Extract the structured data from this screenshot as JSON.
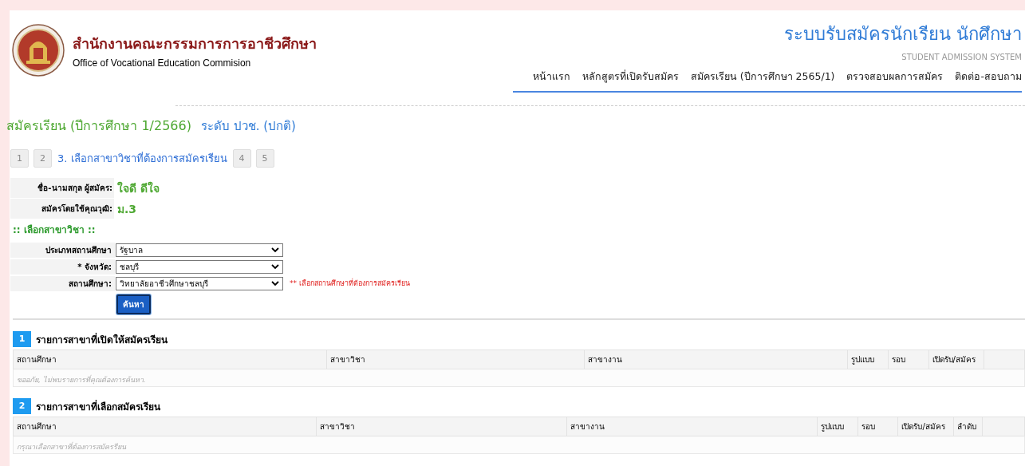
{
  "header": {
    "org_name_th": "สำนักงานคณะกรรมการการอาชีวศึกษา",
    "org_name_en": "Office of Vocational Education Commision",
    "system_title": "ระบบรับสมัครนักเรียน นักศึกษา",
    "system_subtitle": "STUDENT ADMISSION SYSTEM"
  },
  "nav": [
    "หน้าแรก",
    "หลักสูตรที่เปิดรับสมัคร",
    "สมัครเรียน (ปีการศึกษา 2565/1)",
    "ตรวจสอบผลการสมัคร",
    "ติดต่อ-สอบถาม"
  ],
  "page_title": "สมัครเรียน (ปีการศึกษา 1/2566)",
  "level_label": "ระดับ ปวช. (ปกติ)",
  "steps": [
    {
      "label": "1",
      "selected": false
    },
    {
      "label": "2",
      "selected": false
    },
    {
      "label": "3. เลือกสาขาวิชาที่ต้องการสมัครเรียน",
      "selected": true
    },
    {
      "label": "4",
      "selected": false
    },
    {
      "label": "5",
      "selected": false
    }
  ],
  "applicant": [
    {
      "label": "ชื่อ-นามสกุล ผู้สมัคร:",
      "value": "ใจดี ดีใจ"
    },
    {
      "label": "สมัครโดยใช้คุณวุฒิ:",
      "value": "ม.3"
    }
  ],
  "section_title": ":: เลือกสาขาวิชา ::",
  "form": [
    {
      "label": "ประเภทสถานศึกษา",
      "value": "รัฐบาล"
    },
    {
      "label": "* จังหวัด:",
      "value": "ชลบุรี"
    },
    {
      "label": "สถานศึกษา:",
      "value": "วิทยาลัยอาชีวศึกษาชลบุรี",
      "note": "** เลือกสถานศึกษาที่ต้องการสมัครเรียน"
    }
  ],
  "search_button": "ค้นหา",
  "tables": [
    {
      "number": "1",
      "title": "รายการสาขาที่เปิดให้สมัครเรียน",
      "columns": [
        "สถานศึกษา",
        "สาขาวิชา",
        "สาขางาน",
        "รูปแบบ",
        "รอบ",
        "เปิดรับ/สมัคร"
      ],
      "empty_message": "ขออภัย, ไม่พบรายการที่คุณต้องการค้นหา."
    },
    {
      "number": "2",
      "title": "รายการสาขาที่เลือกสมัครเรียน",
      "columns": [
        "สถานศึกษา",
        "สาขาวิชา",
        "สาขางาน",
        "รูปแบบ",
        "รอบ",
        "เปิดรับ/สมัคร",
        "ลำดับ"
      ],
      "empty_message": "กรุณาเลือกสาขาที่ต้องการสมัครรียน"
    }
  ]
}
